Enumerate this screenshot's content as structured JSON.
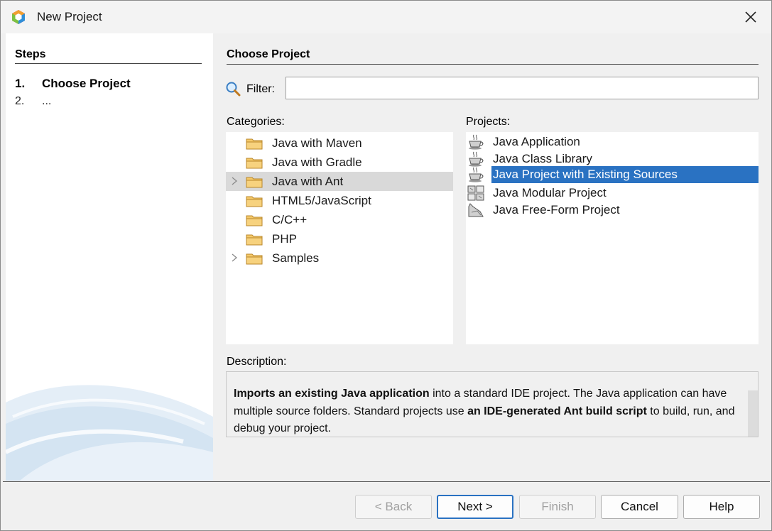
{
  "window": {
    "title": "New Project",
    "close_glyph": "✕"
  },
  "steps": {
    "heading": "Steps",
    "items": [
      {
        "num": "1.",
        "label": "Choose Project"
      },
      {
        "num": "2.",
        "label": "..."
      }
    ]
  },
  "main": {
    "heading": "Choose Project",
    "filter": {
      "label": "Filter:",
      "value": "",
      "placeholder": ""
    },
    "categories_label": "Categories:",
    "projects_label": "Projects:",
    "categories": [
      {
        "label": "Java with Maven",
        "expandable": false
      },
      {
        "label": "Java with Gradle",
        "expandable": false
      },
      {
        "label": "Java with Ant",
        "expandable": true,
        "selected": true
      },
      {
        "label": "HTML5/JavaScript",
        "expandable": false
      },
      {
        "label": "C/C++",
        "expandable": false
      },
      {
        "label": "PHP",
        "expandable": false
      },
      {
        "label": "Samples",
        "expandable": true
      }
    ],
    "projects": [
      {
        "label": "Java Application",
        "icon": "coffee-cup-icon"
      },
      {
        "label": "Java Class Library",
        "icon": "coffee-cup-icon"
      },
      {
        "label": "Java Project with Existing Sources",
        "icon": "coffee-cup-icon",
        "selected": true
      },
      {
        "label": "Java Modular Project",
        "icon": "modules-icon"
      },
      {
        "label": "Java Free-Form Project",
        "icon": "free-form-icon"
      }
    ],
    "description_label": "Description:",
    "description": {
      "bold1": "Imports an existing Java application",
      "text1": " into a standard IDE project. The Java application can have multiple source folders. Standard projects use ",
      "bold2": "an IDE-generated Ant build script",
      "text2": " to build, run, and debug your project."
    }
  },
  "buttons": {
    "back": "< Back",
    "next": "Next >",
    "finish": "Finish",
    "cancel": "Cancel",
    "help": "Help"
  },
  "colors": {
    "selection": "#2a72c2",
    "category_selection": "#d9d9d9",
    "folder": "#f5c96a"
  }
}
